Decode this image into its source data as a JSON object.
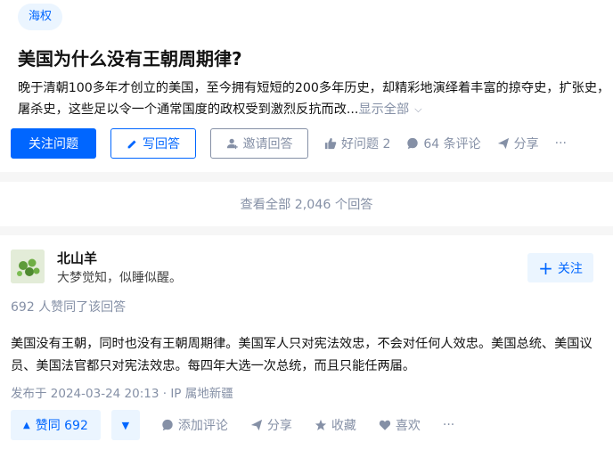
{
  "question": {
    "topic": "海权",
    "title": "美国为什么没有王朝周期律?",
    "description": "晚于清朝100多年才创立的美国，至今拥有短短的200多年历史，却精彩地演绎着丰富的掠夺史，扩张史，屠杀史，这些足以令一个通常国度的政权受到激烈反抗而改...",
    "show_all": "显示全部",
    "actions": {
      "follow": "关注问题",
      "write": "写回答",
      "invite": "邀请回答",
      "good_question": "好问题 2",
      "comments": "64 条评论",
      "share": "分享",
      "more": "···"
    }
  },
  "view_all_answers": "查看全部 2,046 个回答",
  "answer": {
    "author_name": "北山羊",
    "author_bio": "大梦觉知，似睡似醒。",
    "follow": "关注",
    "vote_summary": "692 人赞同了该回答",
    "content": "美国没有王朝，同时也没有王朝周期律。美国军人只对宪法效忠，不会对任何人效忠。美国总统、美国议员、美国法官都只对宪法效忠。每四年大选一次总统，而且只能任两届。",
    "publish_info": "发布于 2024-03-24 20:13 · IP 属地新疆",
    "actions": {
      "upvote": "赞同 692",
      "add_comment": "添加评论",
      "share": "分享",
      "collect": "收藏",
      "like": "喜欢",
      "more": "···"
    }
  },
  "colors": {
    "brand": "#0066ff",
    "muted": "#8590a6",
    "light_blue_bg": "#ebf5ff"
  }
}
